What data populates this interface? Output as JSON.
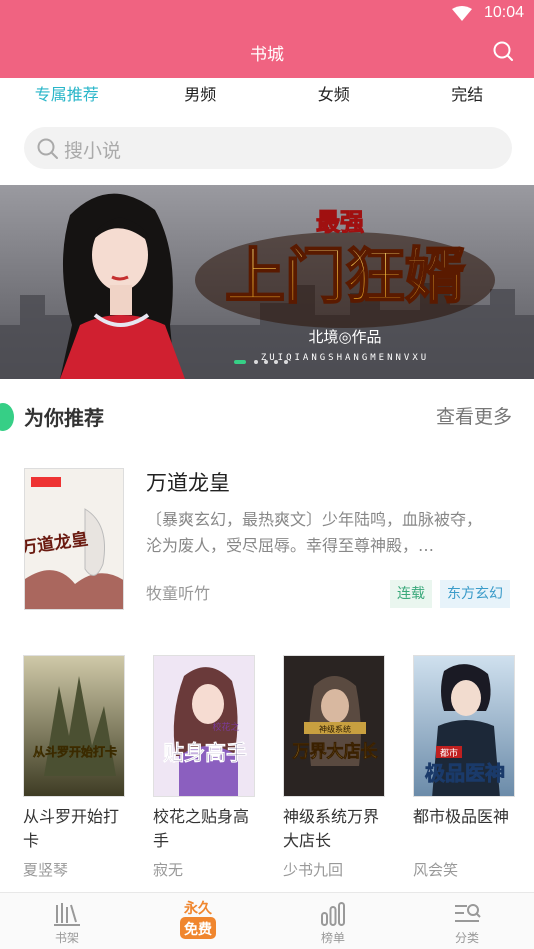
{
  "status": {
    "time": "10:04"
  },
  "header": {
    "title": "书城"
  },
  "tabs": [
    {
      "label": "专属推荐",
      "active": true
    },
    {
      "label": "男频"
    },
    {
      "label": "女频"
    },
    {
      "label": "完结"
    }
  ],
  "search": {
    "placeholder": "搜小说"
  },
  "banner": {
    "badge": "最强",
    "title": "上门狂婿",
    "byline": "北境◎作品",
    "pinyin": "ZUIQIANGSHANGMENNVXU"
  },
  "section": {
    "title": "为你推荐",
    "more": "查看更多"
  },
  "featured": {
    "title": "万道龙皇",
    "description": "〔暴爽玄幻，最热爽文〕少年陆鸣，血脉被夺，沦为废人，受尽屈辱。幸得至尊神殿，…",
    "author": "牧童听竹",
    "tags": [
      "连载",
      "东方玄幻"
    ],
    "cover_text": "万道龙皇"
  },
  "books": [
    {
      "title": "从斗罗开始打卡",
      "author": "夏竖琴",
      "cover_text": "从斗罗开始打卡"
    },
    {
      "title": "校花之贴身高手",
      "author": "寂无",
      "cover_text": "贴身高手",
      "cover_sub": "校花之"
    },
    {
      "title": "神级系统万界大店长",
      "author": "少书九回",
      "cover_text": "万界大店长",
      "cover_sub": "神级系统"
    },
    {
      "title": "都市极品医神",
      "author": "风会笑",
      "cover_text": "极品医神",
      "cover_sub": "都市"
    }
  ],
  "nav": [
    {
      "label": "书架",
      "icon": "bookshelf-icon"
    },
    {
      "label": "免费",
      "badge_top": "永久",
      "icon": "free-badge-icon",
      "active": true
    },
    {
      "label": "榜单",
      "icon": "ranking-icon"
    },
    {
      "label": "分类",
      "icon": "category-icon"
    }
  ],
  "colors": {
    "header": "#f06381",
    "tab_active": "#29b6c9",
    "section_dot": "#36cf86"
  }
}
